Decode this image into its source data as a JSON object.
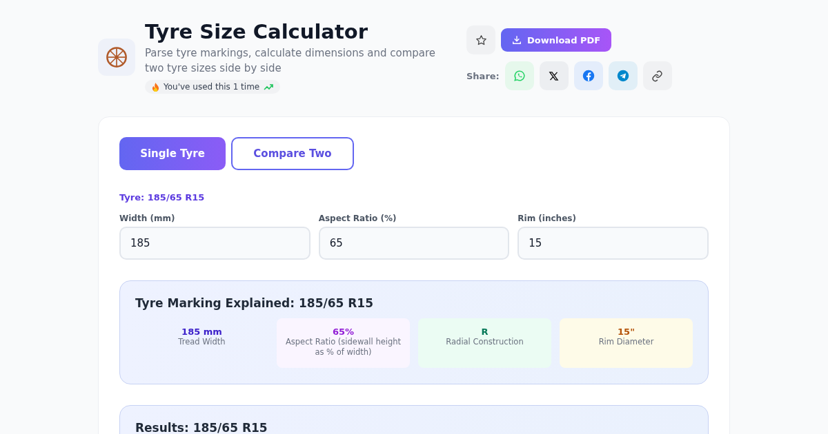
{
  "header": {
    "title": "Tyre Size Calculator",
    "subtitle": "Parse tyre markings, calculate dimensions and compare two tyre sizes side by side",
    "usage": "You've used this 1 time"
  },
  "actions": {
    "download": "Download PDF",
    "share_label": "Share:",
    "share": [
      {
        "kind": "whatsapp"
      },
      {
        "kind": "x"
      },
      {
        "kind": "facebook"
      },
      {
        "kind": "telegram"
      },
      {
        "kind": "link"
      }
    ]
  },
  "tabs": [
    {
      "label": "Single Tyre",
      "selected": true
    },
    {
      "label": "Compare Two",
      "selected": false
    }
  ],
  "tyre_label": "Tyre: 185/65 R15",
  "fields": [
    {
      "label": "Width (mm)",
      "value": "185"
    },
    {
      "label": "Aspect Ratio (%)",
      "value": "65"
    },
    {
      "label": "Rim (inches)",
      "value": "15"
    }
  ],
  "marking": {
    "title": "Tyre Marking Explained: 185/65 R15",
    "parts": [
      {
        "value": "185 mm",
        "caption": "Tread Width",
        "color": "#3b1fc9"
      },
      {
        "value": "65%",
        "caption": "Aspect Ratio (sidewall height as % of width)",
        "color": "#9320d6"
      },
      {
        "value": "R",
        "caption": "Radial Construction",
        "color": "#047857"
      },
      {
        "value": "15\"",
        "caption": "Rim Diameter",
        "color": "#b45309"
      }
    ]
  },
  "results": {
    "title": "Results: 185/65 R15"
  }
}
